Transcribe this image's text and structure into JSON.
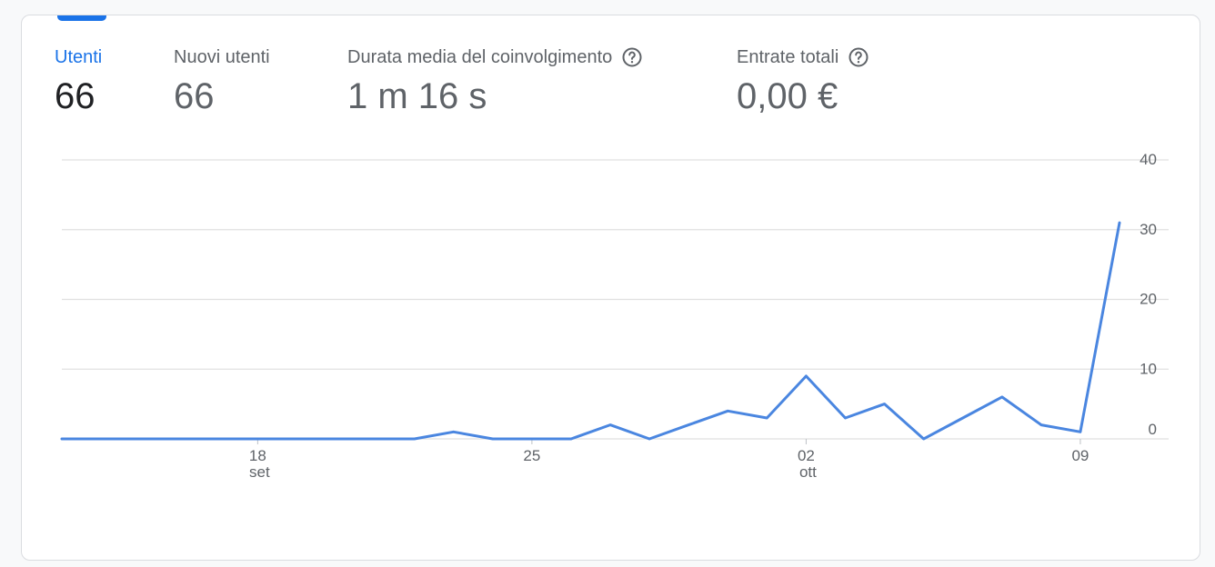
{
  "metrics": [
    {
      "label": "Utenti",
      "value": "66",
      "active": true,
      "help": false
    },
    {
      "label": "Nuovi utenti",
      "value": "66",
      "active": false,
      "help": false
    },
    {
      "label": "Durata media del coinvolgimento",
      "value": "1 m 16 s",
      "active": false,
      "help": true,
      "help_icon": "help-circle-icon"
    },
    {
      "label": "Entrate totali",
      "value": "0,00 €",
      "active": false,
      "help": true,
      "help_icon": "help-circle-icon"
    }
  ],
  "colors": {
    "accent": "#1a73e8",
    "line": "#4a86e0",
    "grid": "#e0e0e0"
  },
  "chart_data": {
    "type": "line",
    "x": [
      "13 set",
      "14 set",
      "15 set",
      "16 set",
      "17 set",
      "18 set",
      "19 set",
      "20 set",
      "21 set",
      "22 set",
      "23 set",
      "24 set",
      "25 set",
      "26 set",
      "27 set",
      "28 set",
      "29 set",
      "30 set",
      "01 ott",
      "02 ott",
      "03 ott",
      "04 ott",
      "05 ott",
      "06 ott",
      "07 ott",
      "08 ott",
      "09 ott",
      "10 ott"
    ],
    "series": [
      {
        "values": [
          0,
          0,
          0,
          0,
          0,
          0,
          0,
          0,
          0,
          0,
          1,
          0,
          0,
          0,
          2,
          0,
          2,
          4,
          3,
          9,
          3,
          5,
          0,
          3,
          6,
          2,
          1,
          31
        ]
      }
    ],
    "xticks": [
      {
        "x": "18 set",
        "day": "18",
        "month": "set"
      },
      {
        "x": "25 set",
        "day": "25",
        "month": ""
      },
      {
        "x": "02 ott",
        "day": "02",
        "month": "ott"
      },
      {
        "x": "09 ott",
        "day": "09",
        "month": ""
      }
    ],
    "yticks": [
      "40",
      "30",
      "20",
      "10",
      "0"
    ],
    "ylim": [
      0,
      40
    ],
    "grid": true
  }
}
